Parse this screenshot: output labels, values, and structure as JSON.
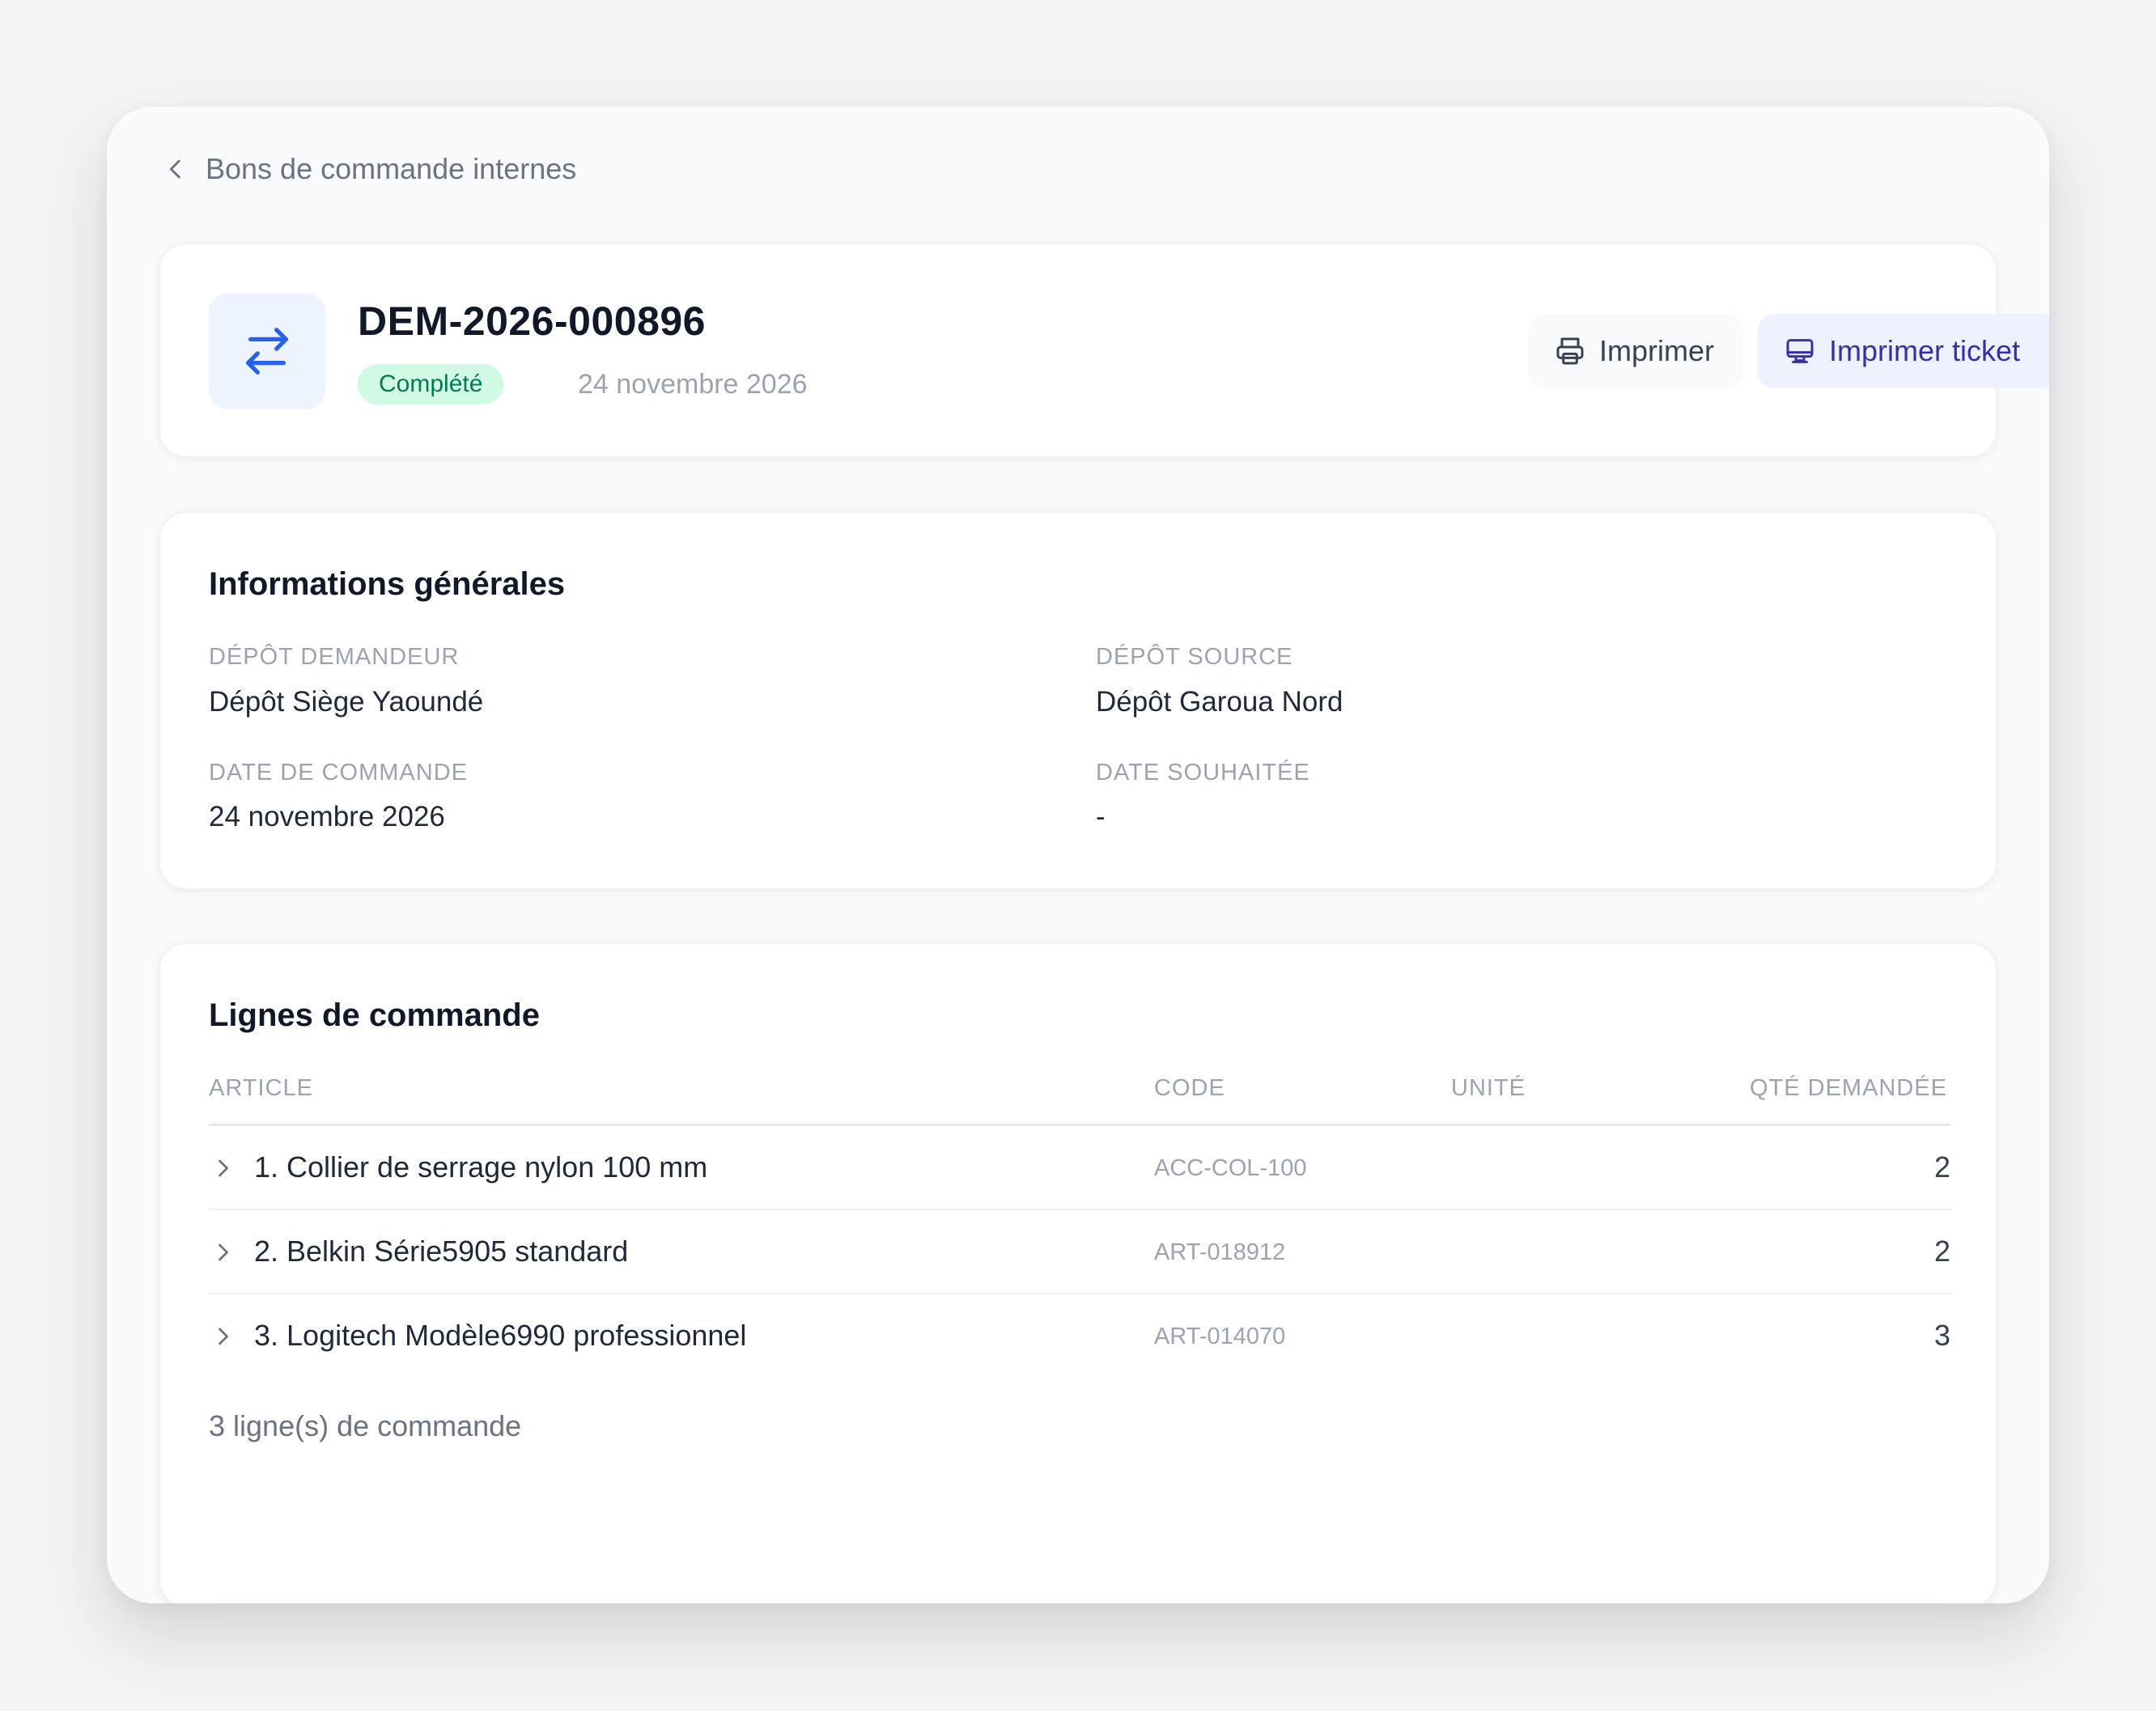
{
  "breadcrumb": {
    "back_label": "Bons de commande internes"
  },
  "header": {
    "order_number": "DEM-2026-000896",
    "status": "Complété",
    "date": "24 novembre 2026",
    "print_label": "Imprimer",
    "print_ticket_label": "Imprimer ticket",
    "icon": "transfer-arrows-icon"
  },
  "info": {
    "title": "Informations générales",
    "requesting_depot_label": "DÉPÔT DEMANDEUR",
    "requesting_depot": "Dépôt Siège Yaoundé",
    "source_depot_label": "DÉPÔT SOURCE",
    "source_depot": "Dépôt Garoua Nord",
    "order_date_label": "DATE DE COMMANDE",
    "order_date": "24 novembre 2026",
    "desired_date_label": "DATE SOUHAITÉE",
    "desired_date": "-"
  },
  "lines": {
    "title": "Lignes de commande",
    "columns": {
      "article": "ARTICLE",
      "code": "CODE",
      "unit": "UNITÉ",
      "qty": "QTÉ DEMANDÉE"
    },
    "rows": [
      {
        "article": "1. Collier de serrage nylon 100 mm",
        "code": "ACC-COL-100",
        "unit": "",
        "qty": "2"
      },
      {
        "article": "2. Belkin Série5905 standard",
        "code": "ART-018912",
        "unit": "",
        "qty": "2"
      },
      {
        "article": "3. Logitech Modèle6990 professionnel",
        "code": "ART-014070",
        "unit": "",
        "qty": "3"
      }
    ],
    "count_text": "3 ligne(s) de commande"
  },
  "colors": {
    "accent": "#3730a3",
    "icon_blue": "#2563eb",
    "badge_bg": "#d1fae5",
    "badge_text": "#047857"
  }
}
